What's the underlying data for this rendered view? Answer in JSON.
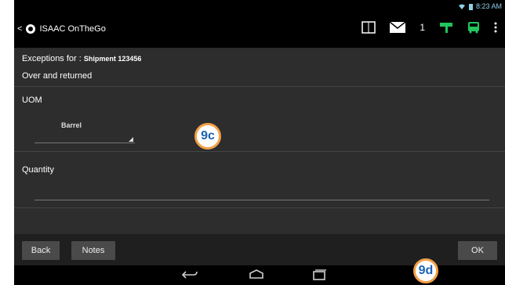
{
  "status": {
    "time": "8:23 AM"
  },
  "app": {
    "back_glyph": "<",
    "title": "ISAAC OnTheGo",
    "icons": [
      "calendar-icon",
      "mail-icon",
      "signal-icon",
      "bus-icon",
      "overflow-menu-icon"
    ],
    "mail_count": "1",
    "calendar_glyph": "1⁄"
  },
  "page": {
    "exceptions_label": "Exceptions for :",
    "shipment": "Shipment 123456",
    "subtitle": "Over and returned",
    "uom_label": "UOM",
    "uom_selected": "Barrel",
    "quantity_label": "Quantity",
    "quantity_value": ""
  },
  "buttons": {
    "back": "Back",
    "notes": "Notes",
    "ok": "OK"
  },
  "nav": {
    "icons": [
      "back-nav-icon",
      "home-nav-icon",
      "recents-nav-icon"
    ]
  },
  "callouts": {
    "c1": "9c",
    "c2": "9d"
  },
  "colors": {
    "callout_border": "#f2a04a",
    "callout_text": "#1a63b5",
    "accent_green": "#22c55e"
  }
}
